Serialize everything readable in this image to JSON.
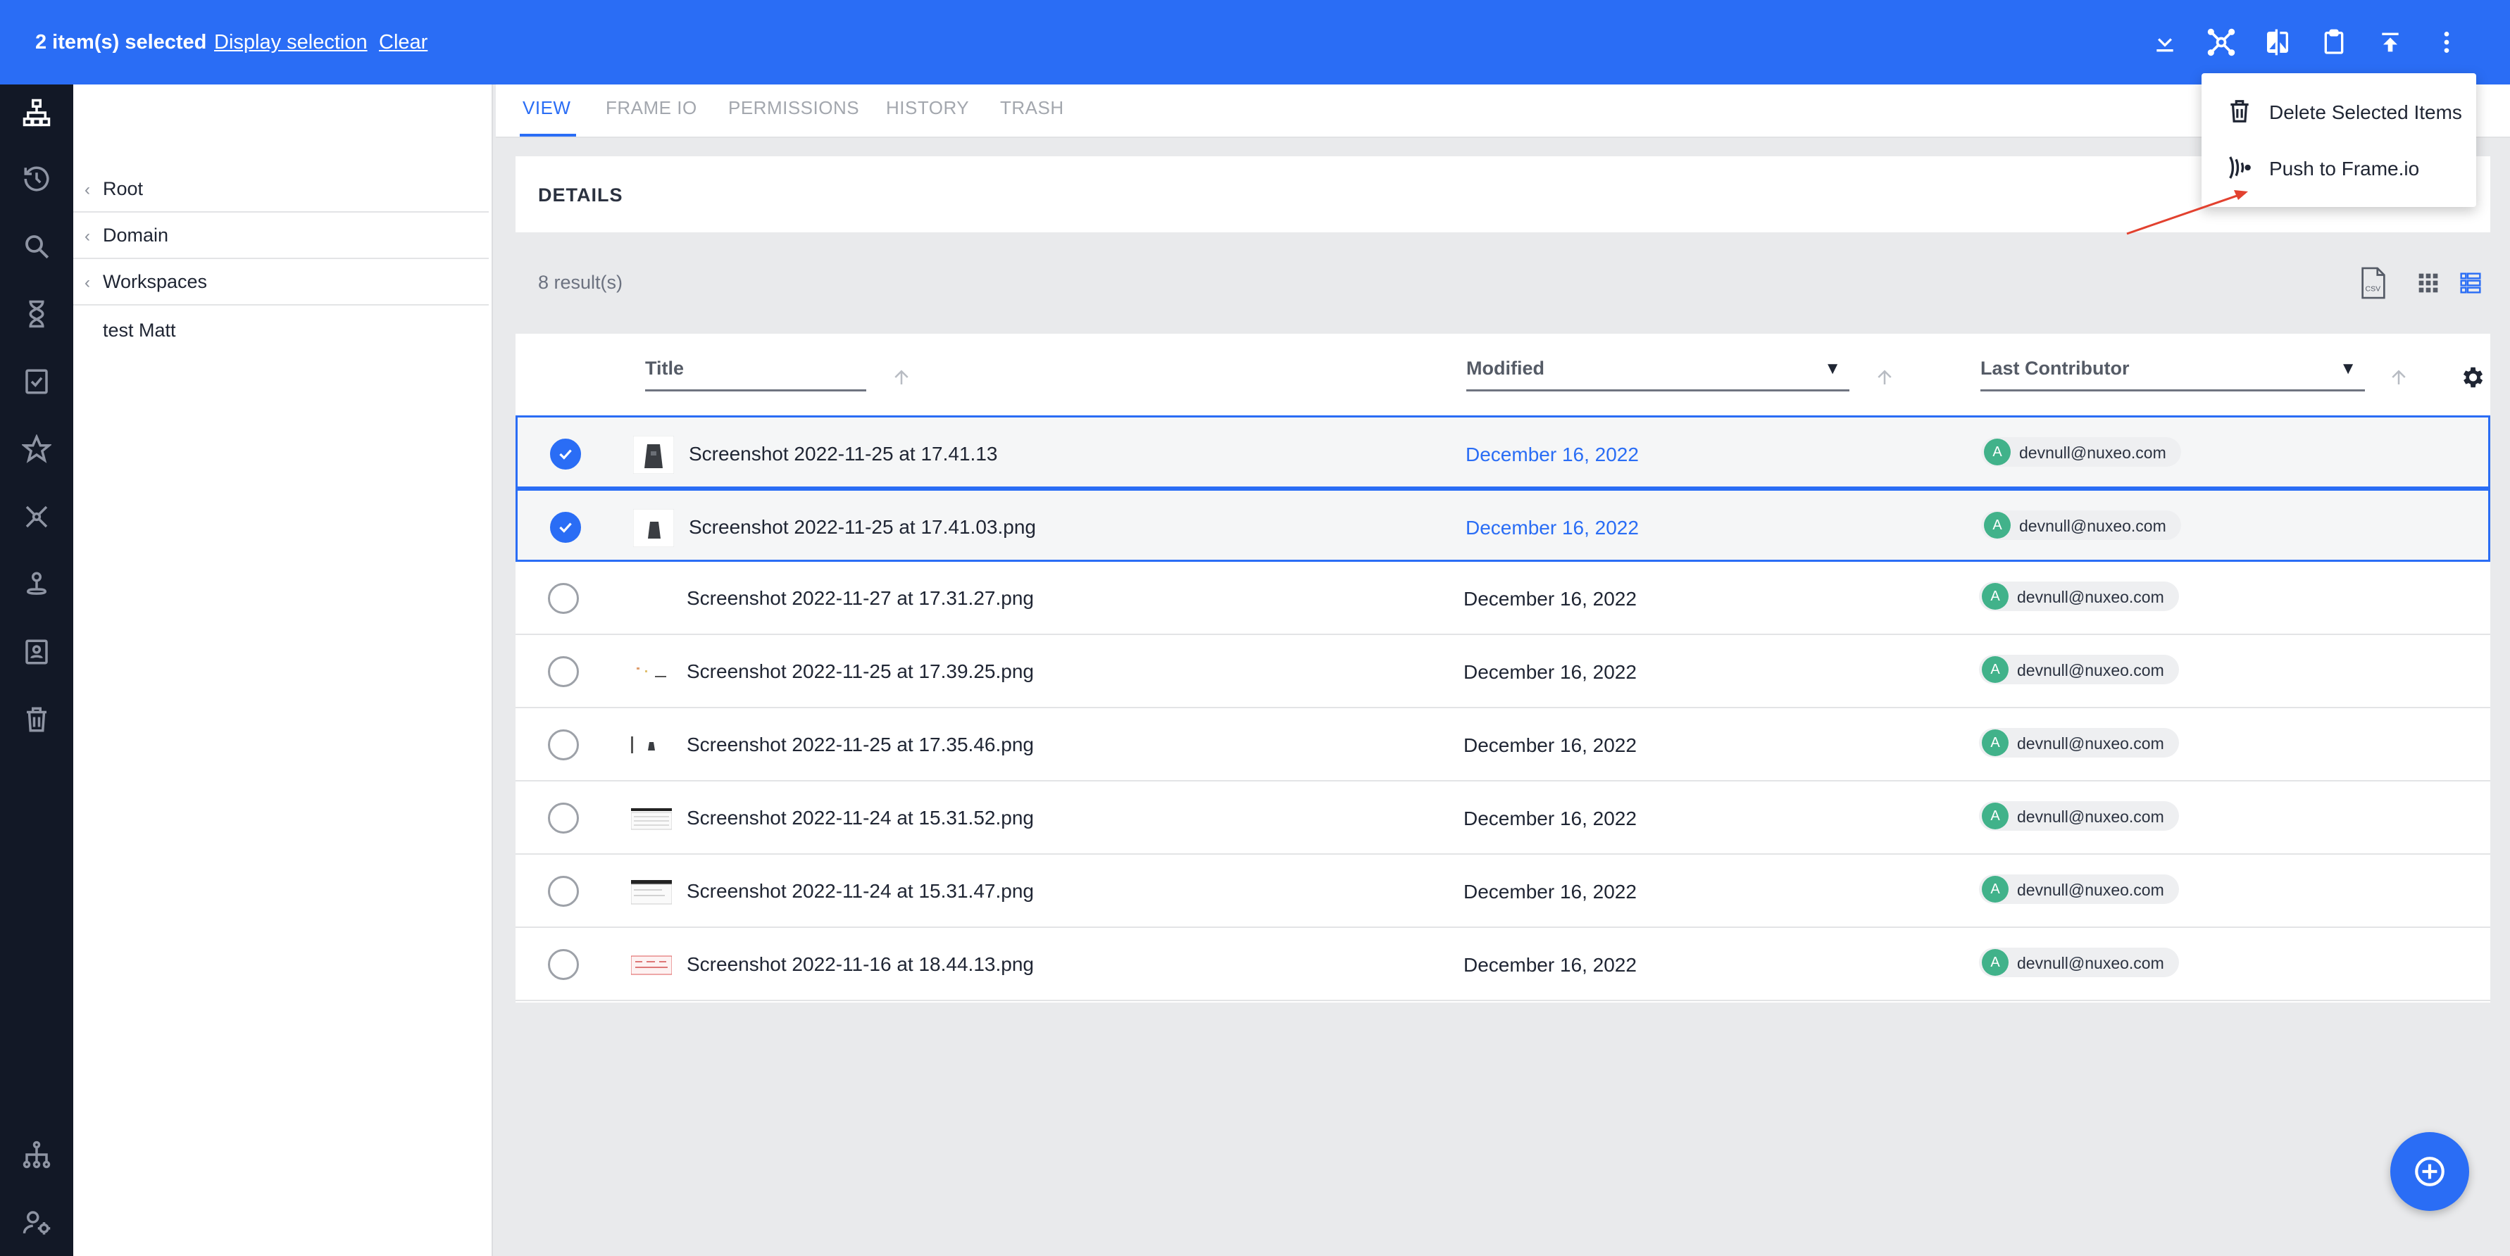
{
  "selection_bar": {
    "count_text": "2 item(s) selected",
    "display_selection_label": "Display selection",
    "clear_label": "Clear",
    "actions": [
      "download-icon",
      "frameio-network-icon",
      "compare-icon",
      "clipboard-icon",
      "upload-icon",
      "more-vert-icon"
    ]
  },
  "rail": {
    "icons": [
      "hierarchy-icon",
      "history-icon",
      "search-icon",
      "hourglass-icon",
      "tasks-icon",
      "star-icon",
      "network-icon",
      "user-map-icon",
      "contact-badge-icon",
      "trash-icon",
      "org-chart-icon",
      "user-settings-icon"
    ]
  },
  "tree": {
    "items": [
      {
        "label": "Root",
        "chevron": "‹"
      },
      {
        "label": "Domain",
        "chevron": "‹"
      },
      {
        "label": "Workspaces",
        "chevron": "‹"
      },
      {
        "label": "test Matt"
      }
    ]
  },
  "tabs": [
    {
      "label": "VIEW",
      "active": true
    },
    {
      "label": "FRAME IO"
    },
    {
      "label": "PERMISSIONS"
    },
    {
      "label": "HISTORY"
    },
    {
      "label": "TRASH"
    }
  ],
  "details": {
    "title": "DETAILS"
  },
  "results": {
    "count_text": "8 result(s)"
  },
  "table": {
    "columns": {
      "title": "Title",
      "modified": "Modified",
      "last_contributor": "Last Contributor"
    },
    "filter_caret": "▼",
    "rows": [
      {
        "title": "Screenshot 2022-11-25 at 17.41.13",
        "modified": "December 16, 2022",
        "contributor_initial": "A",
        "contributor": "devnull@nuxeo.com",
        "selected": true
      },
      {
        "title": "Screenshot 2022-11-25 at 17.41.03.png",
        "modified": "December 16, 2022",
        "contributor_initial": "A",
        "contributor": "devnull@nuxeo.com",
        "selected": true
      },
      {
        "title": "Screenshot 2022-11-27 at 17.31.27.png",
        "modified": "December 16, 2022",
        "contributor_initial": "A",
        "contributor": "devnull@nuxeo.com",
        "selected": false
      },
      {
        "title": "Screenshot 2022-11-25 at 17.39.25.png",
        "modified": "December 16, 2022",
        "contributor_initial": "A",
        "contributor": "devnull@nuxeo.com",
        "selected": false
      },
      {
        "title": "Screenshot 2022-11-25 at 17.35.46.png",
        "modified": "December 16, 2022",
        "contributor_initial": "A",
        "contributor": "devnull@nuxeo.com",
        "selected": false
      },
      {
        "title": "Screenshot 2022-11-24 at 15.31.52.png",
        "modified": "December 16, 2022",
        "contributor_initial": "A",
        "contributor": "devnull@nuxeo.com",
        "selected": false
      },
      {
        "title": "Screenshot 2022-11-24 at 15.31.47.png",
        "modified": "December 16, 2022",
        "contributor_initial": "A",
        "contributor": "devnull@nuxeo.com",
        "selected": false
      },
      {
        "title": "Screenshot 2022-11-16 at 18.44.13.png",
        "modified": "December 16, 2022",
        "contributor_initial": "A",
        "contributor": "devnull@nuxeo.com",
        "selected": false
      }
    ]
  },
  "menu": {
    "items": [
      {
        "label": "Delete Selected Items",
        "icon": "trash-icon"
      },
      {
        "label": "Push to Frame.io",
        "icon": "frameio-logo-icon"
      }
    ]
  },
  "colors": {
    "accent": "#2a6df5",
    "rail": "#121826",
    "avatar": "#41b28a",
    "annotation": "#e2412f"
  }
}
